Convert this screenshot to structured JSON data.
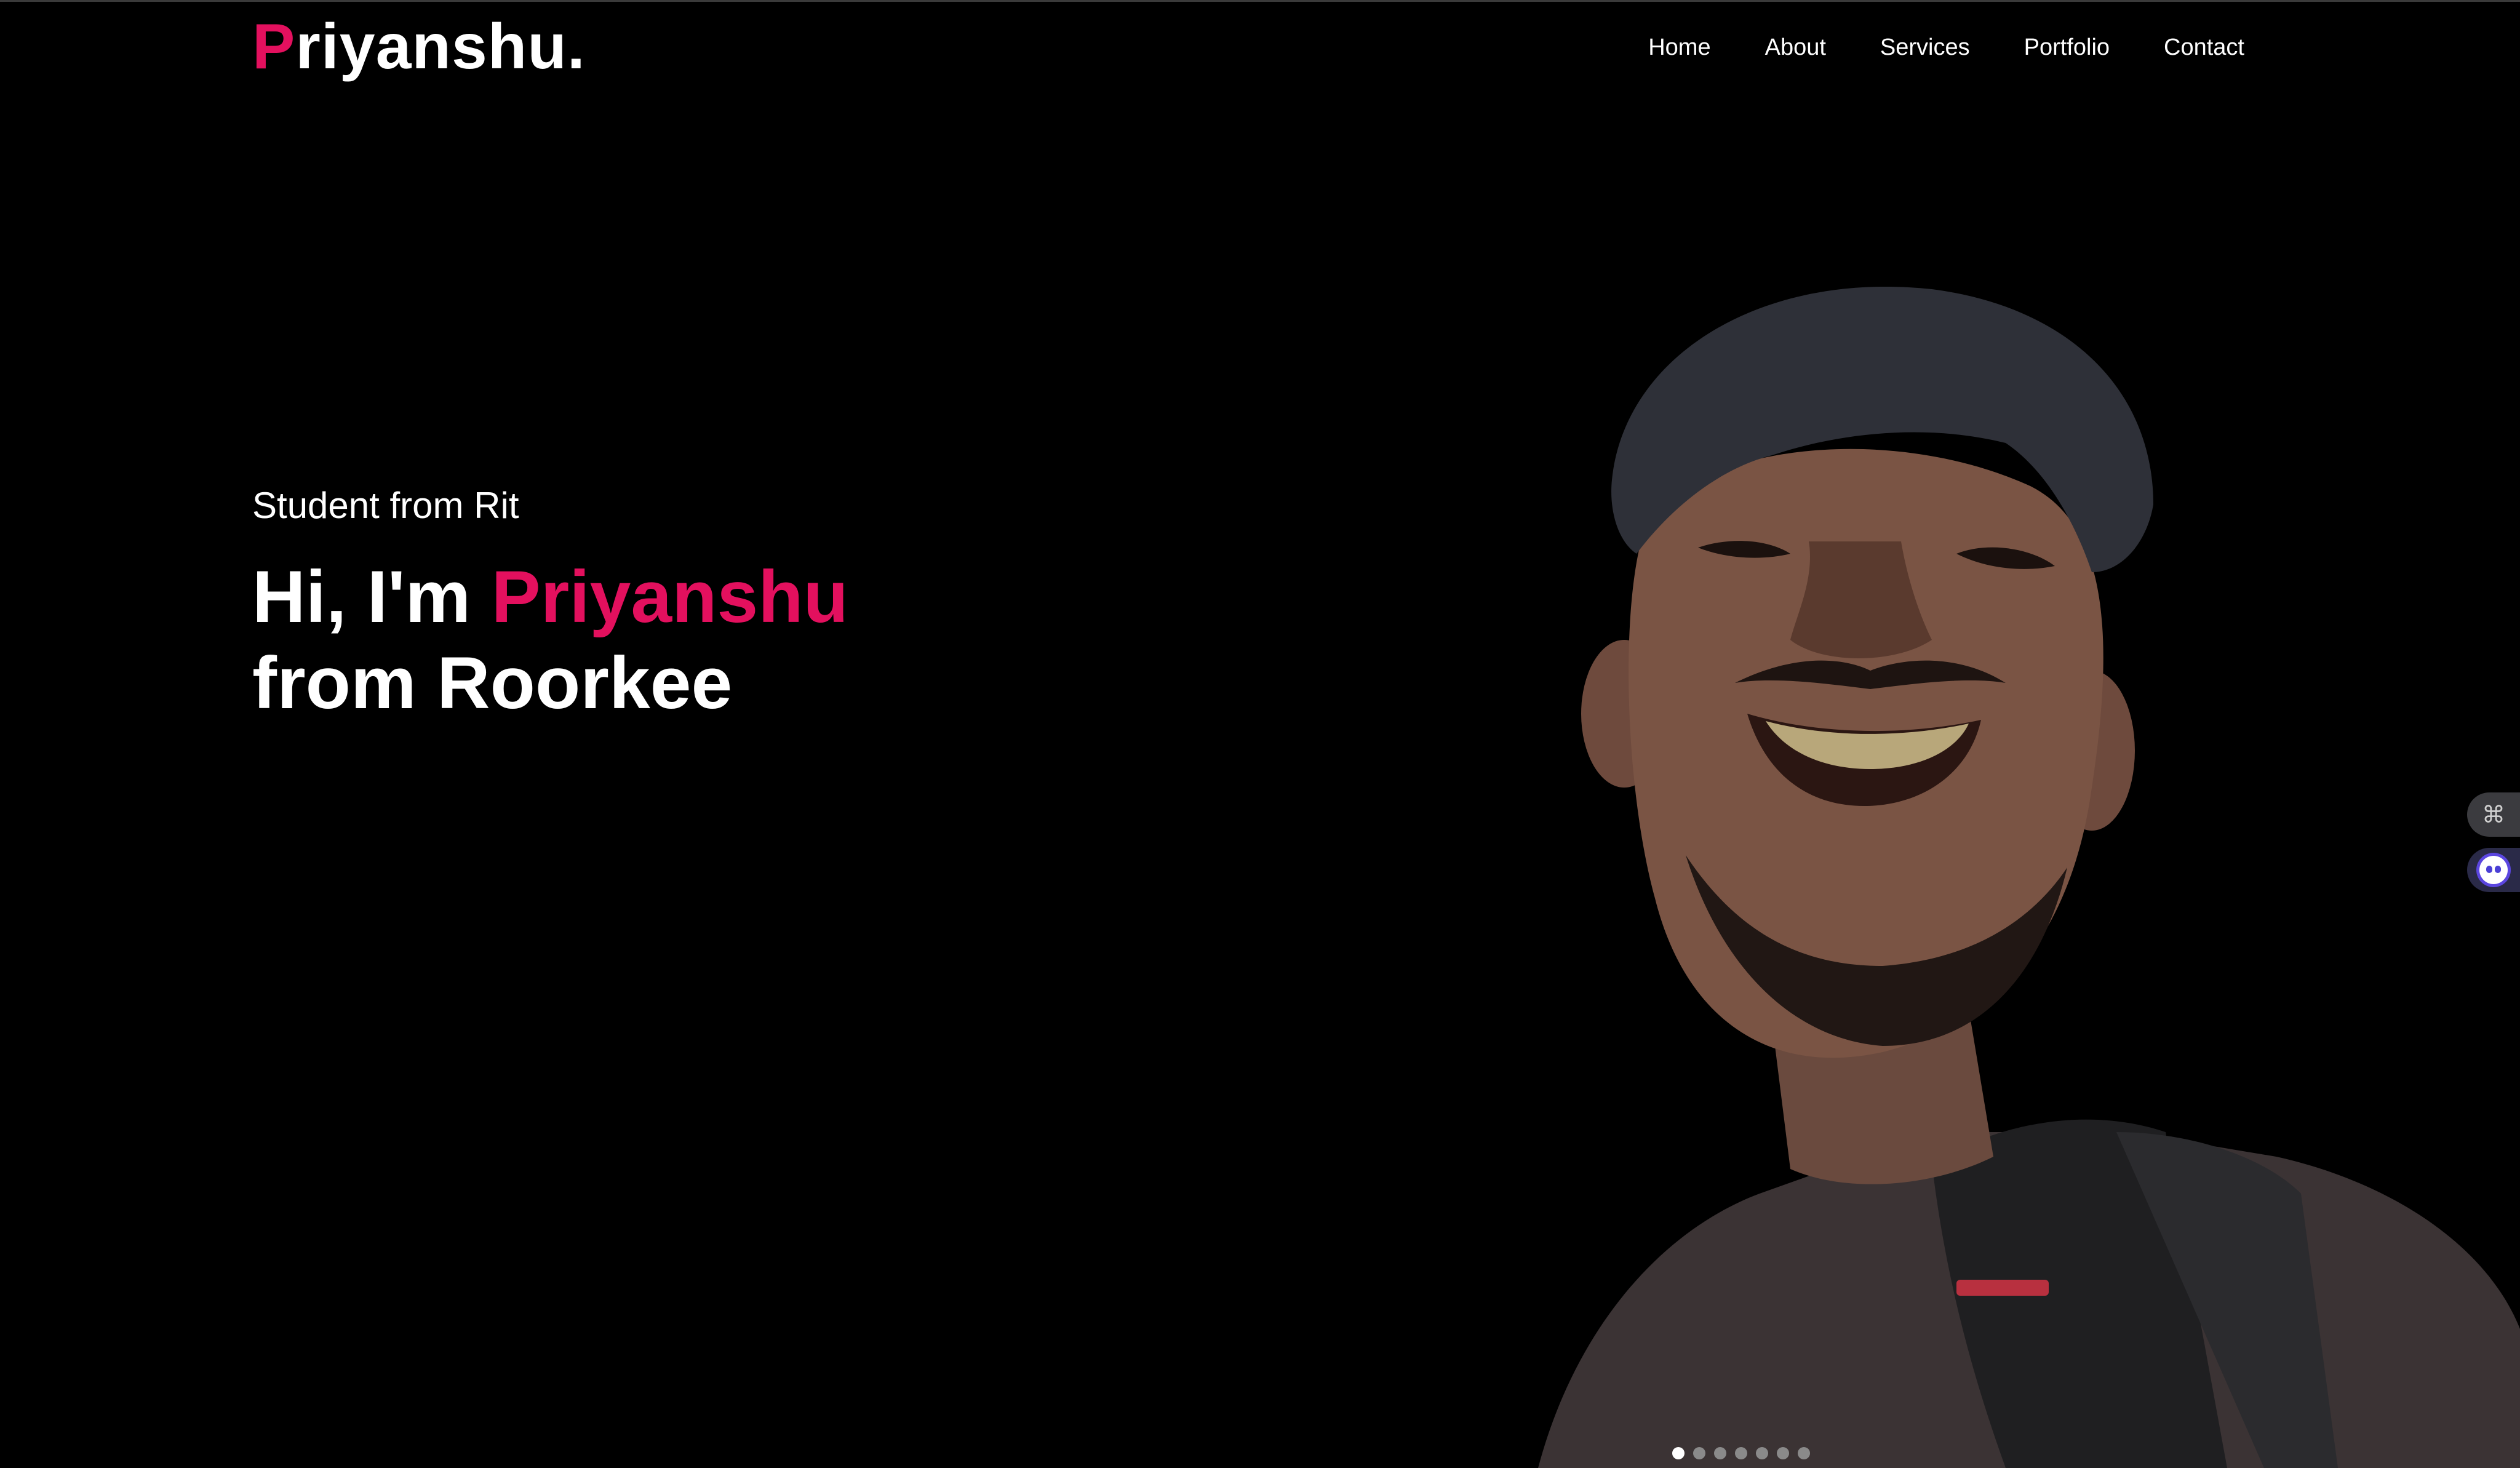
{
  "header": {
    "logo_initial": "P",
    "logo_rest": "riyanshu."
  },
  "nav": {
    "items": [
      "Home",
      "About",
      "Services",
      "Portfolio",
      "Contact"
    ]
  },
  "hero": {
    "subtitle": "Student from Rit",
    "greeting": "Hi, I'm ",
    "name": "Priyanshu",
    "line2": "from Roorkee"
  },
  "widgets": {
    "icon_1": "command-icon",
    "icon_2": "chat-bot-icon"
  },
  "slider": {
    "total": 7,
    "active": 1
  },
  "colors": {
    "background": "#000000",
    "accent": "#e3105e",
    "text": "#ffffff"
  }
}
